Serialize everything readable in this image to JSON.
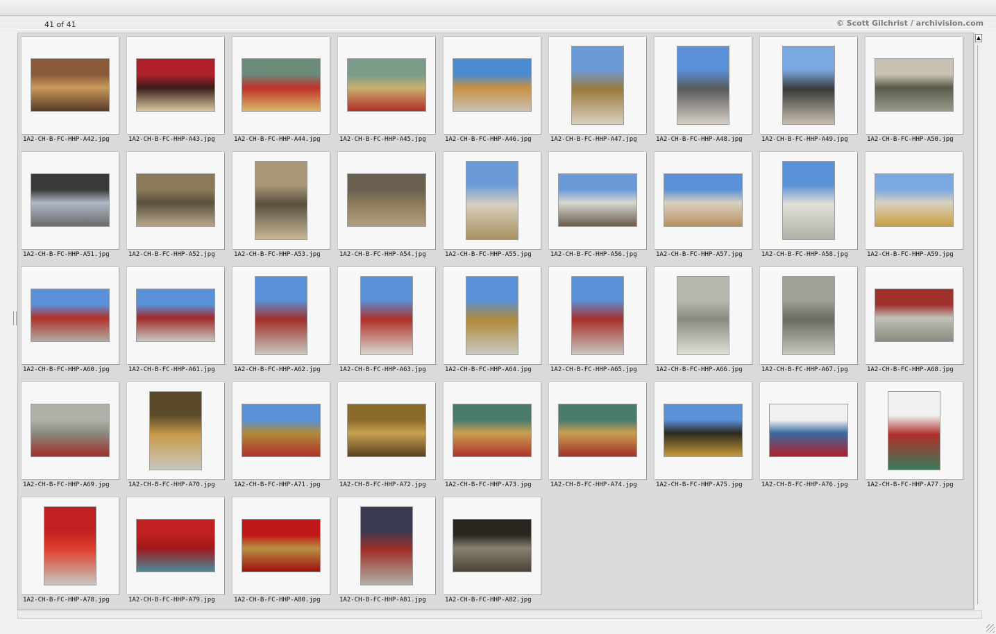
{
  "header": {
    "counter": "41 of 41",
    "credit": "© Scott Gilchrist / archivision.com"
  },
  "items": [
    {
      "file": "1A2-CH-B-FC-HHP-A42.jpg",
      "orient": "l",
      "colors": [
        "#8a5a3a",
        "#c89a5a",
        "#5a3a2a"
      ]
    },
    {
      "file": "1A2-CH-B-FC-HHP-A43.jpg",
      "orient": "l",
      "colors": [
        "#b0202a",
        "#3a1a1a",
        "#d8c8a0"
      ]
    },
    {
      "file": "1A2-CH-B-FC-HHP-A44.jpg",
      "orient": "l",
      "colors": [
        "#6a8a7a",
        "#c0302a",
        "#d8b868"
      ]
    },
    {
      "file": "1A2-CH-B-FC-HHP-A45.jpg",
      "orient": "l",
      "colors": [
        "#7a9a8a",
        "#c8b070",
        "#b0302a"
      ]
    },
    {
      "file": "1A2-CH-B-FC-HHP-A46.jpg",
      "orient": "l",
      "colors": [
        "#4a8ad0",
        "#c89040",
        "#c8c0b0"
      ]
    },
    {
      "file": "1A2-CH-B-FC-HHP-A47.jpg",
      "orient": "p",
      "colors": [
        "#6a9ad8",
        "#9a7a3a",
        "#d8d0c0"
      ]
    },
    {
      "file": "1A2-CH-B-FC-HHP-A48.jpg",
      "orient": "p",
      "colors": [
        "#5a90d8",
        "#5a5a5a",
        "#d8d0c8"
      ]
    },
    {
      "file": "1A2-CH-B-FC-HHP-A49.jpg",
      "orient": "p",
      "colors": [
        "#7aa8e0",
        "#3a3a3a",
        "#c8c0b0"
      ]
    },
    {
      "file": "1A2-CH-B-FC-HHP-A50.jpg",
      "orient": "l",
      "colors": [
        "#c8c0b0",
        "#5a5a4a",
        "#9a9a8a"
      ]
    },
    {
      "file": "1A2-CH-B-FC-HHP-A51.jpg",
      "orient": "l",
      "colors": [
        "#3a3a3a",
        "#b0b8c8",
        "#6a6a6a"
      ]
    },
    {
      "file": "1A2-CH-B-FC-HHP-A52.jpg",
      "orient": "l",
      "colors": [
        "#8a7a5a",
        "#5a5040",
        "#b8a888"
      ]
    },
    {
      "file": "1A2-CH-B-FC-HHP-A53.jpg",
      "orient": "p",
      "colors": [
        "#a89878",
        "#5a5040",
        "#c8b898"
      ]
    },
    {
      "file": "1A2-CH-B-FC-HHP-A54.jpg",
      "orient": "l",
      "colors": [
        "#6a6050",
        "#8a7a5a",
        "#b0a080"
      ]
    },
    {
      "file": "1A2-CH-B-FC-HHP-A55.jpg",
      "orient": "p",
      "colors": [
        "#6a9ad8",
        "#d8d0c0",
        "#a89060"
      ]
    },
    {
      "file": "1A2-CH-B-FC-HHP-A56.jpg",
      "orient": "l",
      "colors": [
        "#6a9ad8",
        "#d8d8d0",
        "#6a5a4a"
      ]
    },
    {
      "file": "1A2-CH-B-FC-HHP-A57.jpg",
      "orient": "l",
      "colors": [
        "#5a90d8",
        "#d8d0c0",
        "#b89060"
      ]
    },
    {
      "file": "1A2-CH-B-FC-HHP-A58.jpg",
      "orient": "p",
      "colors": [
        "#5a90d8",
        "#e0e0d8",
        "#b0b0a8"
      ]
    },
    {
      "file": "1A2-CH-B-FC-HHP-A59.jpg",
      "orient": "l",
      "colors": [
        "#7aa8e0",
        "#d8d0c0",
        "#c8a040"
      ]
    },
    {
      "file": "1A2-CH-B-FC-HHP-A60.jpg",
      "orient": "l",
      "colors": [
        "#5a90d8",
        "#b0302a",
        "#b0aca0"
      ]
    },
    {
      "file": "1A2-CH-B-FC-HHP-A61.jpg",
      "orient": "l",
      "colors": [
        "#5a90d8",
        "#a0282a",
        "#c8c8c0"
      ]
    },
    {
      "file": "1A2-CH-B-FC-HHP-A62.jpg",
      "orient": "p",
      "colors": [
        "#5a90d8",
        "#a0302a",
        "#c8c8c0"
      ]
    },
    {
      "file": "1A2-CH-B-FC-HHP-A63.jpg",
      "orient": "p",
      "colors": [
        "#5a90d8",
        "#b0302a",
        "#d8d8d0"
      ]
    },
    {
      "file": "1A2-CH-B-FC-HHP-A64.jpg",
      "orient": "p",
      "colors": [
        "#5a90d8",
        "#b08a3a",
        "#c8c8c0"
      ]
    },
    {
      "file": "1A2-CH-B-FC-HHP-A65.jpg",
      "orient": "p",
      "colors": [
        "#5a90d8",
        "#a8302a",
        "#c8c8c0"
      ]
    },
    {
      "file": "1A2-CH-B-FC-HHP-A66.jpg",
      "orient": "p",
      "colors": [
        "#b8b8b0",
        "#8a8a80",
        "#e0e0d8"
      ]
    },
    {
      "file": "1A2-CH-B-FC-HHP-A67.jpg",
      "orient": "p",
      "colors": [
        "#a0a098",
        "#6a6a60",
        "#c8c8c0"
      ]
    },
    {
      "file": "1A2-CH-B-FC-HHP-A68.jpg",
      "orient": "l",
      "colors": [
        "#a0302a",
        "#c0c0b8",
        "#8a8a80"
      ]
    },
    {
      "file": "1A2-CH-B-FC-HHP-A69.jpg",
      "orient": "l",
      "colors": [
        "#b0b0a8",
        "#8a8a80",
        "#a0302a"
      ]
    },
    {
      "file": "1A2-CH-B-FC-HHP-A70.jpg",
      "orient": "p",
      "colors": [
        "#5a4a2a",
        "#c89a4a",
        "#c8c8c0"
      ]
    },
    {
      "file": "1A2-CH-B-FC-HHP-A71.jpg",
      "orient": "l",
      "colors": [
        "#5a90d8",
        "#b08a3a",
        "#b0302a"
      ]
    },
    {
      "file": "1A2-CH-B-FC-HHP-A72.jpg",
      "orient": "l",
      "colors": [
        "#8a6a2a",
        "#c8a050",
        "#5a4020"
      ]
    },
    {
      "file": "1A2-CH-B-FC-HHP-A73.jpg",
      "orient": "l",
      "colors": [
        "#4a7a6a",
        "#c8a050",
        "#b0302a"
      ]
    },
    {
      "file": "1A2-CH-B-FC-HHP-A74.jpg",
      "orient": "l",
      "colors": [
        "#4a7a6a",
        "#c8a050",
        "#a0302a"
      ]
    },
    {
      "file": "1A2-CH-B-FC-HHP-A75.jpg",
      "orient": "l",
      "colors": [
        "#5a90d8",
        "#2a2a20",
        "#c89a3a"
      ]
    },
    {
      "file": "1A2-CH-B-FC-HHP-A76.jpg",
      "orient": "l",
      "colors": [
        "#f0f0f0",
        "#3a6aa0",
        "#b0202a"
      ]
    },
    {
      "file": "1A2-CH-B-FC-HHP-A77.jpg",
      "orient": "p",
      "colors": [
        "#f0f0f0",
        "#b0302a",
        "#3a7a5a"
      ]
    },
    {
      "file": "1A2-CH-B-FC-HHP-A78.jpg",
      "orient": "p",
      "colors": [
        "#c02020",
        "#e04030",
        "#c8c8c0"
      ]
    },
    {
      "file": "1A2-CH-B-FC-HHP-A79.jpg",
      "orient": "l",
      "colors": [
        "#c02020",
        "#a01818",
        "#4a8a9a"
      ]
    },
    {
      "file": "1A2-CH-B-FC-HHP-A80.jpg",
      "orient": "l",
      "colors": [
        "#c01818",
        "#b89040",
        "#a01010"
      ]
    },
    {
      "file": "1A2-CH-B-FC-HHP-A81.jpg",
      "orient": "p",
      "colors": [
        "#3a3a50",
        "#a0302a",
        "#b0b0a8"
      ]
    },
    {
      "file": "1A2-CH-B-FC-HHP-A82.jpg",
      "orient": "l",
      "colors": [
        "#2a2620",
        "#8a8070",
        "#4a4438"
      ]
    }
  ]
}
